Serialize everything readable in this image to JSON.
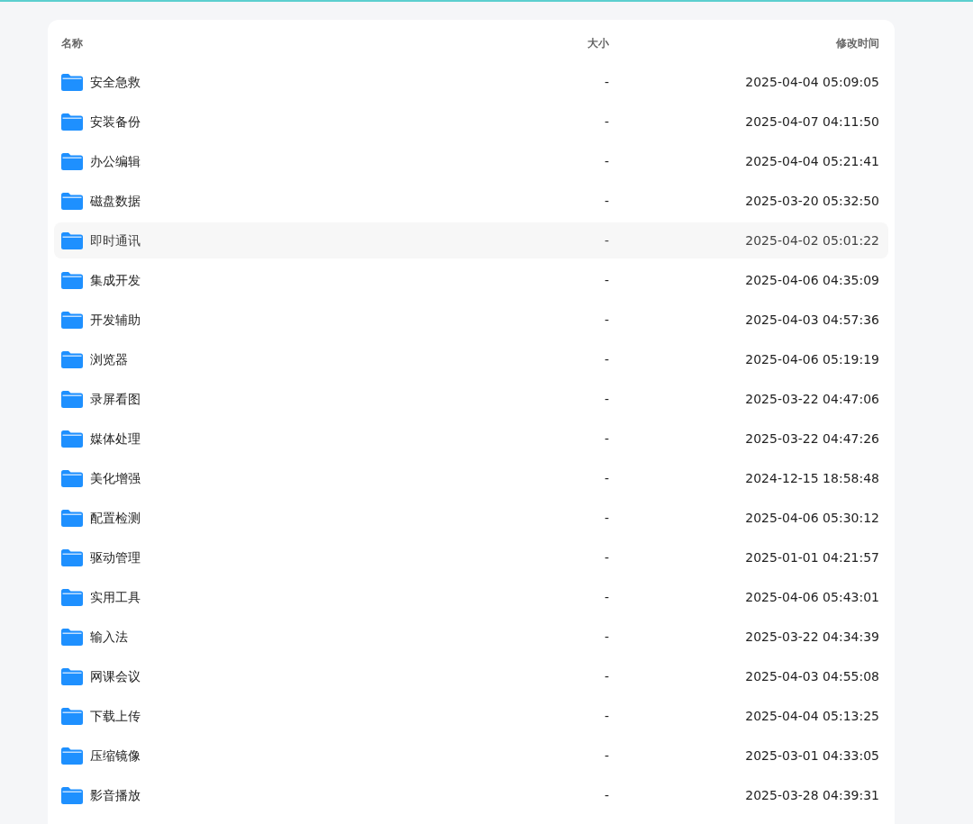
{
  "columns": [
    "名称",
    "大小",
    "修改时间"
  ],
  "rows": [
    {
      "name": "安全急救",
      "size": "-",
      "modified": "2025-04-04 05:09:05",
      "highlighted": false
    },
    {
      "name": "安装备份",
      "size": "-",
      "modified": "2025-04-07 04:11:50",
      "highlighted": false
    },
    {
      "name": "办公编辑",
      "size": "-",
      "modified": "2025-04-04 05:21:41",
      "highlighted": false
    },
    {
      "name": "磁盘数据",
      "size": "-",
      "modified": "2025-03-20 05:32:50",
      "highlighted": false
    },
    {
      "name": "即时通讯",
      "size": "-",
      "modified": "2025-04-02 05:01:22",
      "highlighted": true
    },
    {
      "name": "集成开发",
      "size": "-",
      "modified": "2025-04-06 04:35:09",
      "highlighted": false
    },
    {
      "name": "开发辅助",
      "size": "-",
      "modified": "2025-04-03 04:57:36",
      "highlighted": false
    },
    {
      "name": "浏览器",
      "size": "-",
      "modified": "2025-04-06 05:19:19",
      "highlighted": false
    },
    {
      "name": "录屏看图",
      "size": "-",
      "modified": "2025-03-22 04:47:06",
      "highlighted": false
    },
    {
      "name": "媒体处理",
      "size": "-",
      "modified": "2025-03-22 04:47:26",
      "highlighted": false
    },
    {
      "name": "美化增强",
      "size": "-",
      "modified": "2024-12-15 18:58:48",
      "highlighted": false
    },
    {
      "name": "配置检测",
      "size": "-",
      "modified": "2025-04-06 05:30:12",
      "highlighted": false
    },
    {
      "name": "驱动管理",
      "size": "-",
      "modified": "2025-01-01 04:21:57",
      "highlighted": false
    },
    {
      "name": "实用工具",
      "size": "-",
      "modified": "2025-04-06 05:43:01",
      "highlighted": false
    },
    {
      "name": "输入法",
      "size": "-",
      "modified": "2025-03-22 04:34:39",
      "highlighted": false
    },
    {
      "name": "网课会议",
      "size": "-",
      "modified": "2025-04-03 04:55:08",
      "highlighted": false
    },
    {
      "name": "下载上传",
      "size": "-",
      "modified": "2025-04-04 05:13:25",
      "highlighted": false
    },
    {
      "name": "压缩镜像",
      "size": "-",
      "modified": "2025-03-01 04:33:05",
      "highlighted": false
    },
    {
      "name": "影音播放",
      "size": "-",
      "modified": "2025-03-28 04:39:31",
      "highlighted": false
    }
  ]
}
